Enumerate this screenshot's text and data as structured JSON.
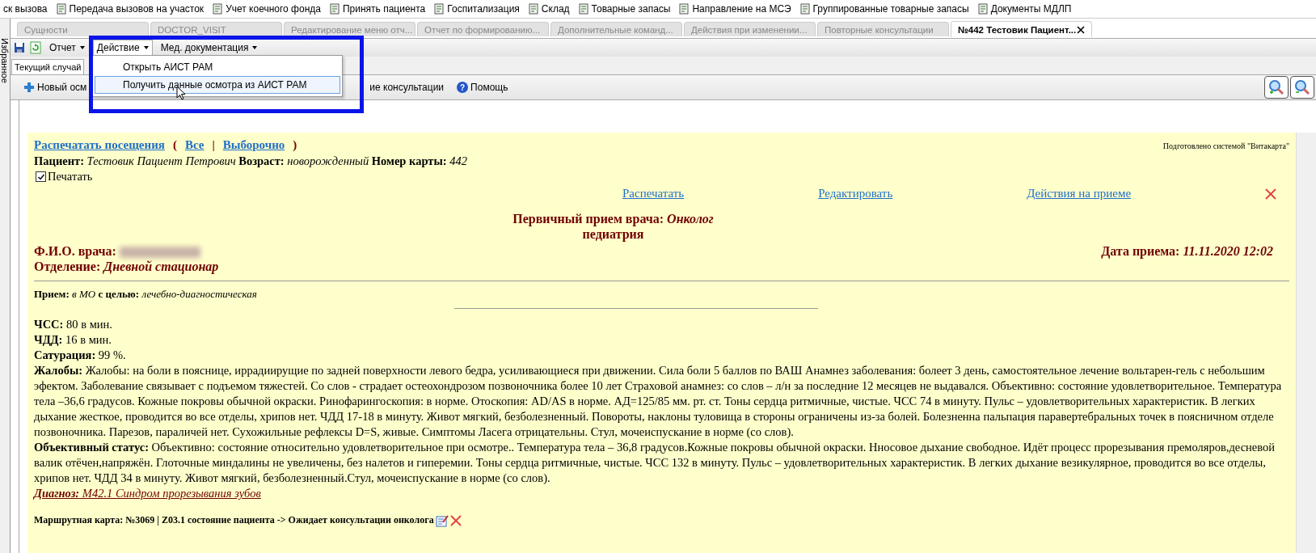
{
  "top_toolbar": {
    "items": [
      "ск вызова",
      "Передача вызовов на участок",
      "Учет коечного фонда",
      "Принять пациента",
      "Госпитализация",
      "Склад",
      "Товарные запасы",
      "Направление на МСЭ",
      "Группированные товарные запасы",
      "Документы МДЛП"
    ]
  },
  "side_panel": {
    "label": "Избранное"
  },
  "tabs": [
    {
      "label": "Сущности",
      "selected": false
    },
    {
      "label": "DOCTOR_VISIT",
      "selected": false
    },
    {
      "label": "Редактирование меню отч...",
      "selected": false
    },
    {
      "label": "Отчет по формированию...",
      "selected": false
    },
    {
      "label": "Дополнительные команд...",
      "selected": false
    },
    {
      "label": "Действия при изменении...",
      "selected": false
    },
    {
      "label": "Повторные консультации",
      "selected": false
    },
    {
      "label": "№442 Тестовик Пациент...",
      "selected": true
    }
  ],
  "menubar": [
    {
      "label": "Отчет",
      "selected": false
    },
    {
      "label": "Действие",
      "selected": true
    },
    {
      "label": "Мед. документация",
      "selected": false
    }
  ],
  "dropdown": [
    {
      "label": "Открыть АИСТ РАМ",
      "selected": false
    },
    {
      "label": "Получить данные осмотра из АИСТ РАМ",
      "selected": true
    }
  ],
  "subtabs": [
    {
      "label": "Текущий случай",
      "selected": true
    }
  ],
  "action_toolbar": {
    "new_exam": "Новый осм",
    "consultations": "ие консультации",
    "help": "Помощь",
    "help_icon": "?"
  },
  "document": {
    "print_links": {
      "print_visits": "Распечатать посещения",
      "open": "(",
      "all": "Все",
      "separator": "|",
      "selective": "Выборочно",
      "close": ")"
    },
    "prepared_by": "Подготовлено системой \"Витакарта\"",
    "patient_line": "**Пациент:** *Тестовик Пациент Петрович* **Возраст:** *новорожденный* **Номер карты:** *442*",
    "print_checkbox": {
      "label": "Печатать",
      "checked": true
    },
    "visit_actions": [
      "Распечатать",
      "Редактировать",
      "Действия на приеме"
    ],
    "heading": "Первичный прием врача: *Онколог*",
    "subheading": "педиатрия",
    "doctor_label": "Ф.И.О. врача:",
    "visit_date": "Дата приема: *11.11.2020 12:02*",
    "department": "Отделение: *Дневной стационар*",
    "reception": "**Прием:** *в МО* **с целью:** *лечебно-диагностическая*",
    "paragraphs": [
      "**ЧСС:** 80 в мин.",
      "**ЧДД:** 16 в мин.",
      "**Сатурация:** 99 %.",
      "**Жалобы:** Жалобы: на боли в пояснице, иррадиирущие по задней поверхности левого бедра, усиливающиеся при движении. Сила боли 5 баллов по ВАШ Анамнез заболевания: болеет 3 день, самостоятельное лечение вольтарен-гель с небольшим эфектом. Заболевание связывает с подъемом тяжестей. Со слов - страдает остеохондрозом позвоночника более 10 лет Страховой анамнез: со слов – л/н за последние 12 месяцев не выдавался. Объективно: состояние удовлетворительное. Температура тела –36,6 градусов. Кожные покровы обычной окраски. Ринофарингоскопия: в норме. Отоскопия: AD/AS в норме. АД=125/85 мм. рт. ст. Тоны сердца ритмичные, чистые. ЧСС 74 в минуту. Пульс – удовлетворительных характеристик. В легких дыхание жесткое, проводится во все отделы, хрипов нет. ЧДД 17-18 в минуту. Живот мягкий, безболезненный. Повороты, наклоны туловища в стороны ограничены из-за болей. Болезненна пальпация паравертебральных точек в поясничном отделе позвоночника. Парезов, параличей нет. Сухожильные рефлексы D=S, живые. Симптомы Ласега отрицательны. Стул, мочеиспускание в норме (со слов).",
      "**Объективный статус:** Объективно: состояние относительно удовлетворительное при осмотре.. Температура тела – 36,8 градусов.Кожные покровы обычной окраски. Нносовое дыхание свободное. Идёт процесс прорезывания премоляров,десневой валик отёчен,напряжён. Глоточные миндалины не увеличены, без налетов и гиперемии. Тоны сердца ритмичные, чистые. ЧСС 132 в минуту. Пульс – удовлетворительных характеристик. В легких дыхание везикулярное, проводится во все отделы, хрипов нет. ЧДД 34 в минуту. Живот мягкий, безболезненный.Стул, мочеиспускание в норме (со слов)."
    ],
    "diagnosis": "**Диагноз:** M42.1 Синдром прорезывания зубов",
    "route_card": "Маршрутная карта: №3069 | Z03.1 состояние пациента -> Ожидает консультации онколога"
  }
}
